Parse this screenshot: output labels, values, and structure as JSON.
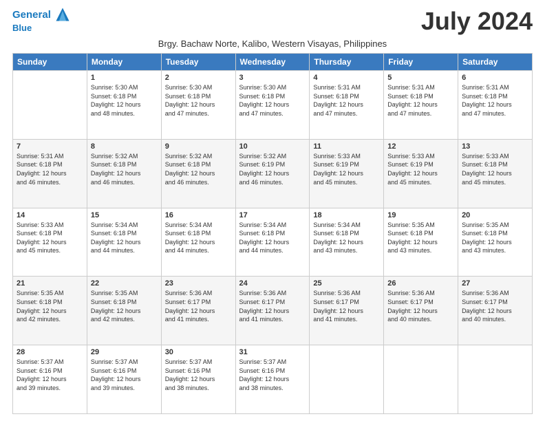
{
  "header": {
    "logo_line1": "General",
    "logo_line2": "Blue",
    "month_title": "July 2024",
    "subtitle": "Brgy. Bachaw Norte, Kalibo, Western Visayas, Philippines"
  },
  "weekdays": [
    "Sunday",
    "Monday",
    "Tuesday",
    "Wednesday",
    "Thursday",
    "Friday",
    "Saturday"
  ],
  "weeks": [
    {
      "shaded": false,
      "days": [
        {
          "num": "",
          "info": ""
        },
        {
          "num": "1",
          "info": "Sunrise: 5:30 AM\nSunset: 6:18 PM\nDaylight: 12 hours\nand 48 minutes."
        },
        {
          "num": "2",
          "info": "Sunrise: 5:30 AM\nSunset: 6:18 PM\nDaylight: 12 hours\nand 47 minutes."
        },
        {
          "num": "3",
          "info": "Sunrise: 5:30 AM\nSunset: 6:18 PM\nDaylight: 12 hours\nand 47 minutes."
        },
        {
          "num": "4",
          "info": "Sunrise: 5:31 AM\nSunset: 6:18 PM\nDaylight: 12 hours\nand 47 minutes."
        },
        {
          "num": "5",
          "info": "Sunrise: 5:31 AM\nSunset: 6:18 PM\nDaylight: 12 hours\nand 47 minutes."
        },
        {
          "num": "6",
          "info": "Sunrise: 5:31 AM\nSunset: 6:18 PM\nDaylight: 12 hours\nand 47 minutes."
        }
      ]
    },
    {
      "shaded": true,
      "days": [
        {
          "num": "7",
          "info": "Sunrise: 5:31 AM\nSunset: 6:18 PM\nDaylight: 12 hours\nand 46 minutes."
        },
        {
          "num": "8",
          "info": "Sunrise: 5:32 AM\nSunset: 6:18 PM\nDaylight: 12 hours\nand 46 minutes."
        },
        {
          "num": "9",
          "info": "Sunrise: 5:32 AM\nSunset: 6:18 PM\nDaylight: 12 hours\nand 46 minutes."
        },
        {
          "num": "10",
          "info": "Sunrise: 5:32 AM\nSunset: 6:19 PM\nDaylight: 12 hours\nand 46 minutes."
        },
        {
          "num": "11",
          "info": "Sunrise: 5:33 AM\nSunset: 6:19 PM\nDaylight: 12 hours\nand 45 minutes."
        },
        {
          "num": "12",
          "info": "Sunrise: 5:33 AM\nSunset: 6:19 PM\nDaylight: 12 hours\nand 45 minutes."
        },
        {
          "num": "13",
          "info": "Sunrise: 5:33 AM\nSunset: 6:18 PM\nDaylight: 12 hours\nand 45 minutes."
        }
      ]
    },
    {
      "shaded": false,
      "days": [
        {
          "num": "14",
          "info": "Sunrise: 5:33 AM\nSunset: 6:18 PM\nDaylight: 12 hours\nand 45 minutes."
        },
        {
          "num": "15",
          "info": "Sunrise: 5:34 AM\nSunset: 6:18 PM\nDaylight: 12 hours\nand 44 minutes."
        },
        {
          "num": "16",
          "info": "Sunrise: 5:34 AM\nSunset: 6:18 PM\nDaylight: 12 hours\nand 44 minutes."
        },
        {
          "num": "17",
          "info": "Sunrise: 5:34 AM\nSunset: 6:18 PM\nDaylight: 12 hours\nand 44 minutes."
        },
        {
          "num": "18",
          "info": "Sunrise: 5:34 AM\nSunset: 6:18 PM\nDaylight: 12 hours\nand 43 minutes."
        },
        {
          "num": "19",
          "info": "Sunrise: 5:35 AM\nSunset: 6:18 PM\nDaylight: 12 hours\nand 43 minutes."
        },
        {
          "num": "20",
          "info": "Sunrise: 5:35 AM\nSunset: 6:18 PM\nDaylight: 12 hours\nand 43 minutes."
        }
      ]
    },
    {
      "shaded": true,
      "days": [
        {
          "num": "21",
          "info": "Sunrise: 5:35 AM\nSunset: 6:18 PM\nDaylight: 12 hours\nand 42 minutes."
        },
        {
          "num": "22",
          "info": "Sunrise: 5:35 AM\nSunset: 6:18 PM\nDaylight: 12 hours\nand 42 minutes."
        },
        {
          "num": "23",
          "info": "Sunrise: 5:36 AM\nSunset: 6:17 PM\nDaylight: 12 hours\nand 41 minutes."
        },
        {
          "num": "24",
          "info": "Sunrise: 5:36 AM\nSunset: 6:17 PM\nDaylight: 12 hours\nand 41 minutes."
        },
        {
          "num": "25",
          "info": "Sunrise: 5:36 AM\nSunset: 6:17 PM\nDaylight: 12 hours\nand 41 minutes."
        },
        {
          "num": "26",
          "info": "Sunrise: 5:36 AM\nSunset: 6:17 PM\nDaylight: 12 hours\nand 40 minutes."
        },
        {
          "num": "27",
          "info": "Sunrise: 5:36 AM\nSunset: 6:17 PM\nDaylight: 12 hours\nand 40 minutes."
        }
      ]
    },
    {
      "shaded": false,
      "days": [
        {
          "num": "28",
          "info": "Sunrise: 5:37 AM\nSunset: 6:16 PM\nDaylight: 12 hours\nand 39 minutes."
        },
        {
          "num": "29",
          "info": "Sunrise: 5:37 AM\nSunset: 6:16 PM\nDaylight: 12 hours\nand 39 minutes."
        },
        {
          "num": "30",
          "info": "Sunrise: 5:37 AM\nSunset: 6:16 PM\nDaylight: 12 hours\nand 38 minutes."
        },
        {
          "num": "31",
          "info": "Sunrise: 5:37 AM\nSunset: 6:16 PM\nDaylight: 12 hours\nand 38 minutes."
        },
        {
          "num": "",
          "info": ""
        },
        {
          "num": "",
          "info": ""
        },
        {
          "num": "",
          "info": ""
        }
      ]
    }
  ]
}
